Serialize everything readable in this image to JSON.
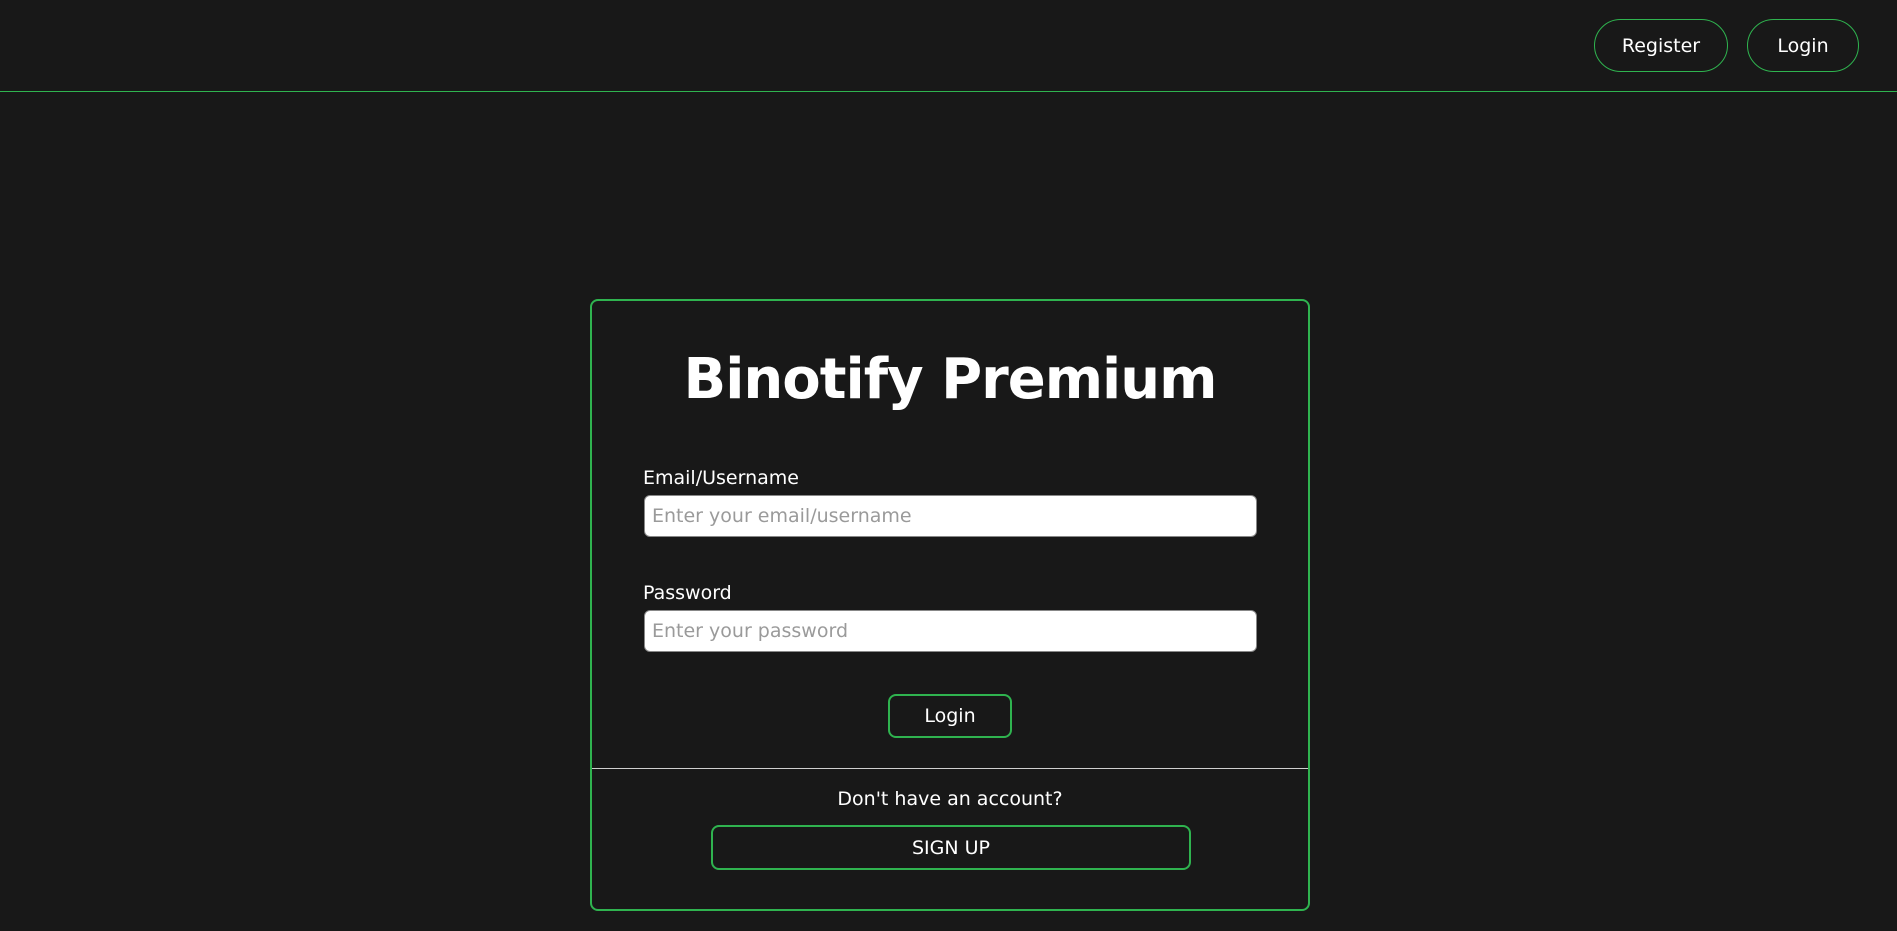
{
  "navbar": {
    "register_label": "Register",
    "login_label": "Login"
  },
  "login_card": {
    "title": "Binotify Premium",
    "email_label": "Email/Username",
    "email_placeholder": "Enter your email/username",
    "email_value": "",
    "password_label": "Password",
    "password_placeholder": "Enter your password",
    "password_value": "",
    "login_button": "Login",
    "signup_prompt": "Don't have an account?",
    "signup_button": "SIGN UP"
  },
  "colors": {
    "background": "#181818",
    "accent": "#2fb34f",
    "text": "#ffffff"
  }
}
